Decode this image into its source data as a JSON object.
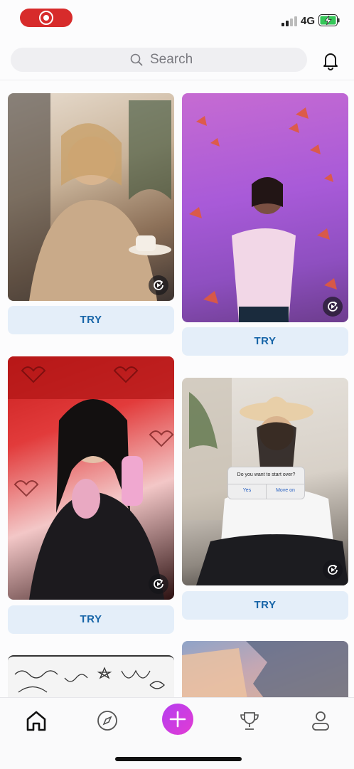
{
  "search": {
    "placeholder": "Search"
  },
  "status": {
    "network": "4G"
  },
  "cards": [
    {
      "button": "TRY"
    },
    {
      "button": "TRY"
    },
    {
      "button": "TRY"
    },
    {
      "button": "TRY"
    }
  ],
  "dialog": {
    "question": "Do you want to start over?",
    "yes": "Yes",
    "move_on": "Move on"
  },
  "tabs": [
    "home-icon",
    "compass-icon",
    "plus-icon",
    "trophy-icon",
    "profile-icon"
  ],
  "colors": {
    "accent": "#1765a8",
    "try_bg": "#e4eef9",
    "create": "#c93ce6",
    "record": "#d72b2b"
  }
}
